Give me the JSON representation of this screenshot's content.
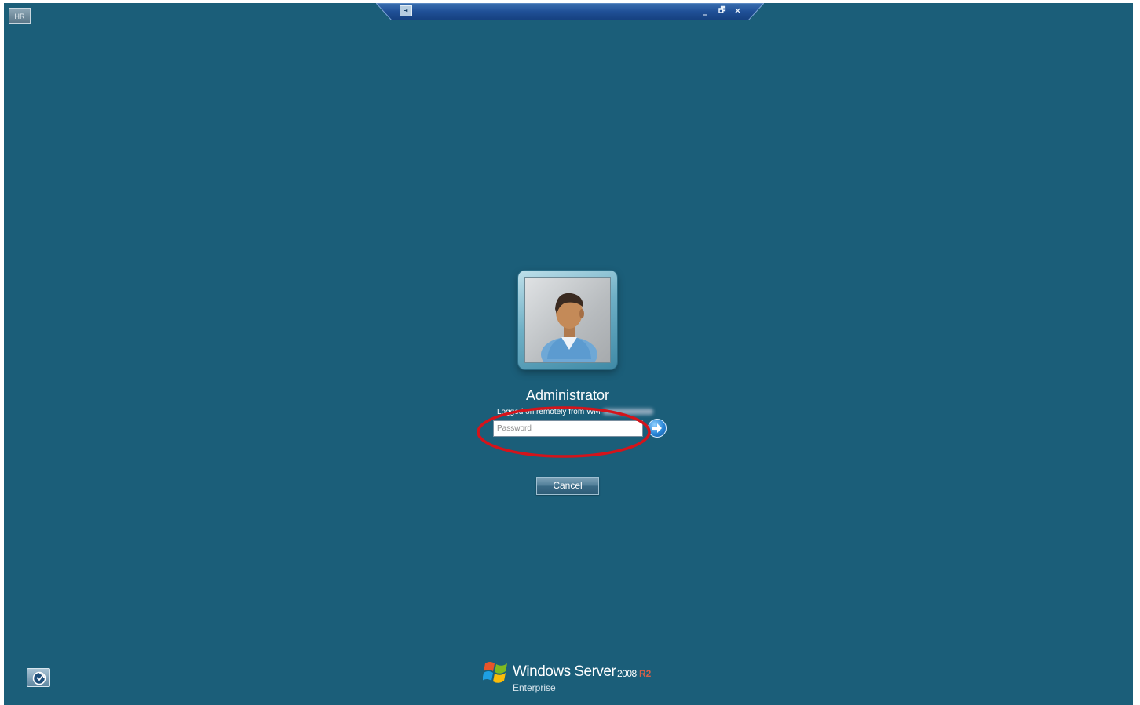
{
  "top_left_badge": "HR",
  "connection_bar": {
    "pin_glyph": "⇥",
    "title_blurred": "",
    "minimize_glyph": "_",
    "restore_glyph": "🗗",
    "close_glyph": "×"
  },
  "logon": {
    "user_name": "Administrator",
    "status_text": "Logged on remotely from WM",
    "password_placeholder": "Password",
    "submit_icon": "arrow-right-icon",
    "cancel_label": "Cancel",
    "highlight_color": "#d4141b"
  },
  "ease_of_access_icon": "ease-of-access-icon",
  "branding": {
    "product": "Windows Server",
    "year": "2008",
    "release": "R2",
    "edition": "Enterprise"
  },
  "colors": {
    "background": "#1b5e79",
    "accent_r2": "#d5614a"
  }
}
